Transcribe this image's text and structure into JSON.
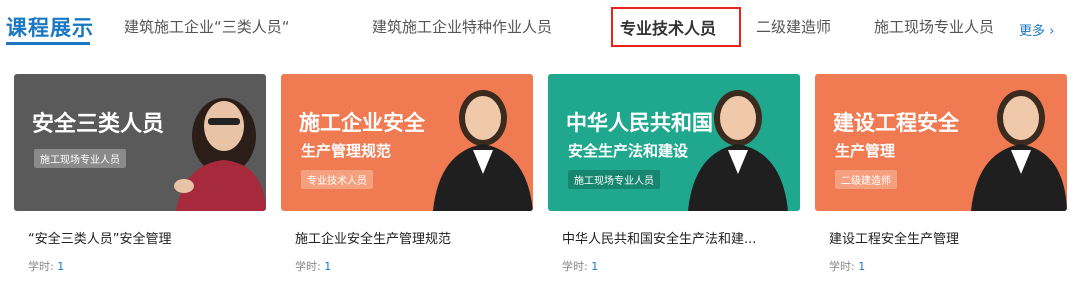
{
  "header": {
    "section_title": "课程展示",
    "tabs": [
      {
        "label": "建筑施工企业“三类人员“"
      },
      {
        "label": "建筑施工企业特种作业人员"
      },
      {
        "label": "专业技术人员"
      },
      {
        "label": "二级建造师"
      },
      {
        "label": "施工现场专业人员"
      }
    ],
    "more_label": "更多",
    "more_icon": "chevron-right-icon"
  },
  "courses": [
    {
      "thumb_title": "安全三类人员",
      "thumb_subtitle": "",
      "thumb_badge": "施工现场专业人员",
      "title": "“安全三类人员”安全管理",
      "meta_label": "学时:",
      "meta_value": "1",
      "bg": "#5a5a5a"
    },
    {
      "thumb_title": "施工企业安全",
      "thumb_subtitle": "生产管理规范",
      "thumb_badge": "专业技术人员",
      "title": "施工企业安全生产管理规范",
      "meta_label": "学时:",
      "meta_value": "1",
      "bg": "#f07a52"
    },
    {
      "thumb_title": "中华人民共和国",
      "thumb_subtitle": "安全生产法和建设",
      "thumb_badge": "施工现场专业人员",
      "title": "中华人民共和国安全生产法和建...",
      "meta_label": "学时:",
      "meta_value": "1",
      "bg": "#1fa88e"
    },
    {
      "thumb_title": "建设工程安全",
      "thumb_subtitle": "生产管理",
      "thumb_badge": "二级建造师",
      "title": "建设工程安全生产管理",
      "meta_label": "学时:",
      "meta_value": "1",
      "bg": "#f07a52"
    }
  ],
  "colors": {
    "accent": "#1a78c2",
    "highlight_border": "#e8231b"
  }
}
